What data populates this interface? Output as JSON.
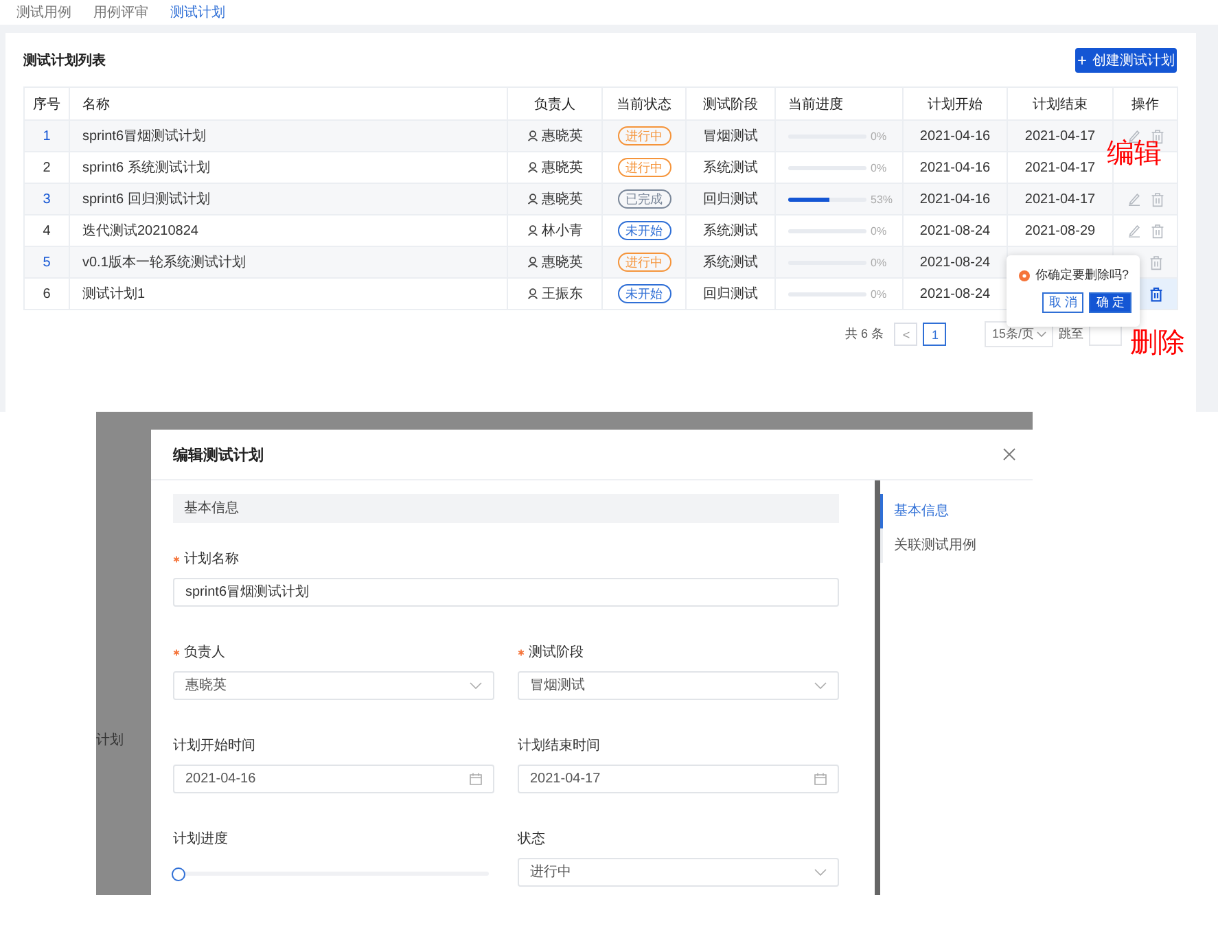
{
  "nav_tabs": [
    {
      "label": "测试用例",
      "selected": false
    },
    {
      "label": "用例评审",
      "selected": false
    },
    {
      "label": "测试计划",
      "selected": true
    }
  ],
  "list": {
    "title": "测试计划列表",
    "create_button": {
      "icon": "+",
      "label": "创建测试计划"
    }
  },
  "table": {
    "columns": [
      "序号",
      "名称",
      "负责人",
      "当前状态",
      "测试阶段",
      "当前进度",
      "计划开始",
      "计划结束",
      "操作"
    ],
    "rows": [
      {
        "index": "1",
        "name": "sprint6冒烟测试计划",
        "owner": "惠晓英",
        "status": {
          "label": "进行中",
          "color": "#f5943a"
        },
        "stage": "冒烟测试",
        "progress": {
          "level": 0,
          "reading": "0%"
        },
        "start": "2021-04-16",
        "end": "2021-04-17",
        "actions": [
          {
            "kind": "edit",
            "active": false
          },
          {
            "kind": "delete",
            "active": false
          }
        ]
      },
      {
        "index": "2",
        "name": "sprint6 系统测试计划",
        "owner": "惠晓英",
        "status": {
          "label": "进行中",
          "color": "#f5943a"
        },
        "stage": "系统测试",
        "progress": {
          "level": 0,
          "reading": "0%"
        },
        "start": "2021-04-16",
        "end": "2021-04-17",
        "actions": []
      },
      {
        "index": "3",
        "name": "sprint6 回归测试计划",
        "owner": "惠晓英",
        "status": {
          "label": "已完成",
          "color": "#7a8799"
        },
        "stage": "回归测试",
        "progress": {
          "level": 0.53,
          "reading": "53%"
        },
        "start": "2021-04-16",
        "end": "2021-04-17",
        "actions": [
          {
            "kind": "edit",
            "active": false
          },
          {
            "kind": "delete",
            "active": false
          }
        ]
      },
      {
        "index": "4",
        "name": "迭代测试20210824",
        "owner": "林小青",
        "status": {
          "label": "未开始",
          "color": "#2f6fd6"
        },
        "stage": "系统测试",
        "progress": {
          "level": 0,
          "reading": "0%"
        },
        "start": "2021-08-24",
        "end": "2021-08-29",
        "actions": [
          {
            "kind": "edit",
            "active": false
          },
          {
            "kind": "delete",
            "active": false
          }
        ]
      },
      {
        "index": "5",
        "name": "v0.1版本一轮系统测试计划",
        "owner": "惠晓英",
        "status": {
          "label": "进行中",
          "color": "#f5943a"
        },
        "stage": "系统测试",
        "progress": {
          "level": 0,
          "reading": "0%"
        },
        "start": "2021-08-24",
        "actions": [
          {
            "kind": "delete",
            "active": false
          }
        ]
      },
      {
        "index": "6",
        "name": "测试计划1",
        "owner": "王振东",
        "status": {
          "label": "未开始",
          "color": "#2f6fd6"
        },
        "stage": "回归测试",
        "progress": {
          "level": 0,
          "reading": "0%"
        },
        "start": "2021-08-24",
        "actions": [
          {
            "kind": "delete",
            "active": true
          }
        ]
      }
    ]
  },
  "pagination": {
    "total": "共 6 条",
    "prev": "<",
    "pages": [
      {
        "label": "1",
        "selected": true
      }
    ],
    "page_size": "15条/页",
    "jump": "跳至"
  },
  "popconfirm": {
    "message": "你确定要删除吗?",
    "cancel": "取 消",
    "confirm": "确 定"
  },
  "annotations": [
    {
      "text": "编辑"
    },
    {
      "text": "删除"
    }
  ],
  "backdrop": {
    "text": "计划"
  },
  "modal": {
    "title": "编辑测试计划",
    "section": "基本信息",
    "fields": [
      {
        "kind": "input",
        "label": "计划名称",
        "required": true,
        "wide": true,
        "value": "sprint6冒烟测试计划"
      },
      {
        "kind": "select",
        "label": "负责人",
        "required": true,
        "value": "惠晓英"
      },
      {
        "kind": "select",
        "label": "测试阶段",
        "required": true,
        "value": "冒烟测试"
      },
      {
        "kind": "date",
        "label": "计划开始时间",
        "required": false,
        "value": "2021-04-16"
      },
      {
        "kind": "date",
        "label": "计划结束时间",
        "required": false,
        "value": "2021-04-17"
      },
      {
        "kind": "slider",
        "label": "计划进度",
        "required": false,
        "level": 0
      },
      {
        "kind": "select",
        "label": "状态",
        "required": false,
        "value": "进行中"
      }
    ],
    "nav": [
      {
        "label": "基本信息",
        "selected": true
      },
      {
        "label": "关联测试用例",
        "selected": false
      }
    ]
  }
}
